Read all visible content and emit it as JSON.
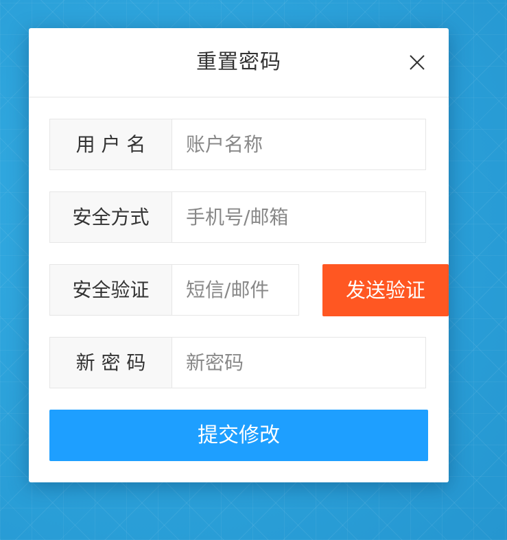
{
  "dialog": {
    "title": "重置密码",
    "close_icon": "close-icon"
  },
  "form": {
    "username": {
      "label": "用 户 名",
      "placeholder": "账户名称",
      "value": ""
    },
    "security_method": {
      "label": "安全方式",
      "placeholder": "手机号/邮箱",
      "value": ""
    },
    "verification": {
      "label": "安全验证",
      "placeholder": "短信/邮件",
      "value": "",
      "send_button_label": "发送验证"
    },
    "new_password": {
      "label": "新 密 码",
      "placeholder": "新密码",
      "value": ""
    },
    "submit_label": "提交修改"
  },
  "colors": {
    "background": "#2a9fd8",
    "send_button": "#ff5722",
    "submit_button": "#1e9fff",
    "label_bg": "#f8f8f8",
    "border": "#e6e6e6"
  }
}
